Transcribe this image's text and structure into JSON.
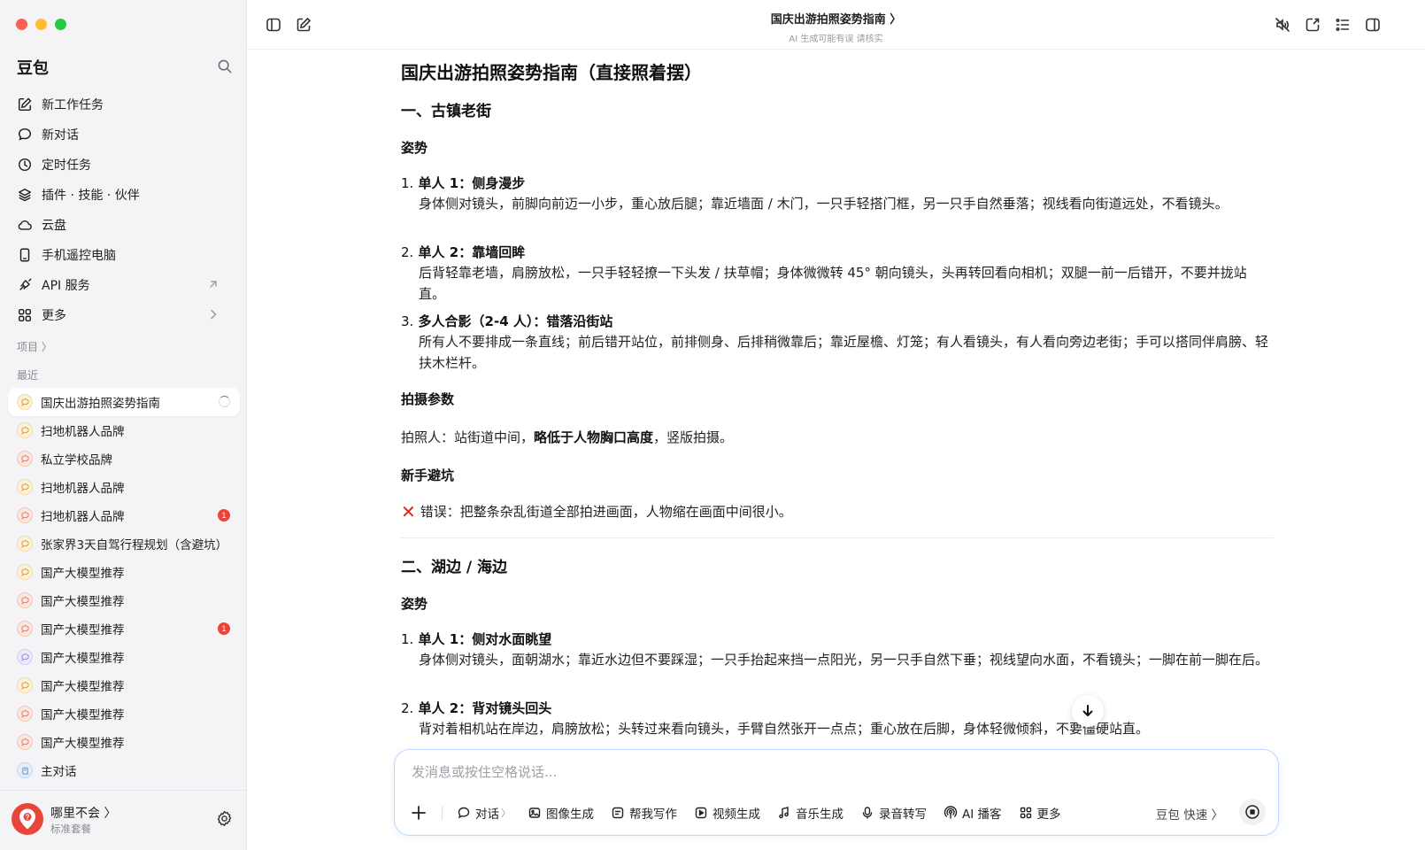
{
  "window": {
    "traffic": [
      "#ff5f57",
      "#febc2e",
      "#28c840"
    ]
  },
  "sidebar": {
    "brand": "豆包",
    "nav": [
      {
        "label": "新工作任务",
        "icon": "edit-icon"
      },
      {
        "label": "新对话",
        "icon": "chat-bubble-icon"
      },
      {
        "label": "定时任务",
        "icon": "clock-icon"
      },
      {
        "label": "插件 · 技能 · 伙伴",
        "icon": "layers-icon"
      },
      {
        "label": "云盘",
        "icon": "cloud-icon"
      },
      {
        "label": "手机遥控电脑",
        "icon": "phone-icon"
      },
      {
        "label": "API 服务",
        "icon": "api-plug-icon"
      },
      {
        "label": "更多",
        "icon": "grid-icon"
      }
    ],
    "projects_label": "项目 〉",
    "recent_label": "最近",
    "recent": [
      {
        "label": "国庆出游拍照姿势指南",
        "state": "loading"
      },
      {
        "label": "扫地机器人品牌"
      },
      {
        "label": "私立学校品牌"
      },
      {
        "label": "扫地机器人品牌"
      },
      {
        "label": "扫地机器人品牌",
        "badge": "1"
      },
      {
        "label": "张家界3天自驾行程规划（含避坑）"
      },
      {
        "label": "国产大模型推荐"
      },
      {
        "label": "国产大模型推荐"
      },
      {
        "label": "国产大模型推荐",
        "badge": "1"
      },
      {
        "label": "国产大模型推荐"
      },
      {
        "label": "国产大模型推荐"
      },
      {
        "label": "国产大模型推荐"
      },
      {
        "label": "国产大模型推荐"
      },
      {
        "label": "主对话"
      }
    ],
    "user": {
      "name": "哪里不会 〉",
      "plan": "标准套餐"
    }
  },
  "header": {
    "title": "国庆出游拍照姿势指南 〉",
    "subtitle": "AI 生成可能有误 请核实"
  },
  "article": {
    "title": "国庆出游拍照姿势指南（直接照着摆）",
    "sec1": {
      "heading": "一、古镇老街",
      "pose_heading": "姿势",
      "items": [
        {
          "num": "1.",
          "title": "单人 1：侧身漫步",
          "body": "身体侧对镜头，前脚向前迈一小步，重心放后腿；靠近墙面 / 木门，一只手轻搭门框，另一只手自然垂落；视线看向街道远处，不看镜头。"
        },
        {
          "num": "2.",
          "title": "单人 2：靠墙回眸",
          "body": "后背轻靠老墙，肩膀放松，一只手轻轻撩一下头发 / 扶草帽；身体微微转 45° 朝向镜头，头再转回看向相机；双腿一前一后错开，不要并拢站直。"
        },
        {
          "num": "3.",
          "title": "多人合影（2-4 人）：错落沿街站",
          "body": "所有人不要排成一条直线；前后错开站位，前排侧身、后排稍微靠后；靠近屋檐、灯笼；有人看镜头，有人看向旁边老街；手可以搭同伴肩膀、轻扶木栏杆。"
        }
      ],
      "params_heading": "拍摄参数",
      "params_prefix": "拍照人：站街道中间，",
      "params_bold": "略低于人物胸口高度",
      "params_suffix": "，竖版拍摄。",
      "tips_heading": "新手避坑",
      "tip_mark": "✕",
      "tip_text": "错误：把整条杂乱街道全部拍进画面，人物缩在画面中间很小。"
    },
    "sec2": {
      "heading": "二、湖边 / 海边",
      "pose_heading": "姿势",
      "items": [
        {
          "num": "1.",
          "title": "单人 1：侧对水面眺望",
          "body": "身体侧对镜头，面朝湖水；靠近水边但不要踩湿；一只手抬起来挡一点阳光，另一只手自然下垂；视线望向水面，不看镜头；一脚在前一脚在后。"
        },
        {
          "num": "2.",
          "title": "单人 2：背对镜头回头",
          "body": "背对着相机站在岸边，肩膀放松；头转过来看向镜头，手臂自然张开一点点；重心放在后脚，身体轻微倾斜，不要僵硬站直。"
        }
      ]
    }
  },
  "composer": {
    "placeholder": "发消息或按住空格说话...",
    "tools": [
      {
        "label": "对话",
        "chev": "〉"
      },
      {
        "label": "图像生成"
      },
      {
        "label": "帮我写作"
      },
      {
        "label": "视频生成"
      },
      {
        "label": "音乐生成"
      },
      {
        "label": "录音转写"
      },
      {
        "label": "AI 播客"
      },
      {
        "label": "更多"
      }
    ],
    "quick": "豆包 快速 〉"
  }
}
